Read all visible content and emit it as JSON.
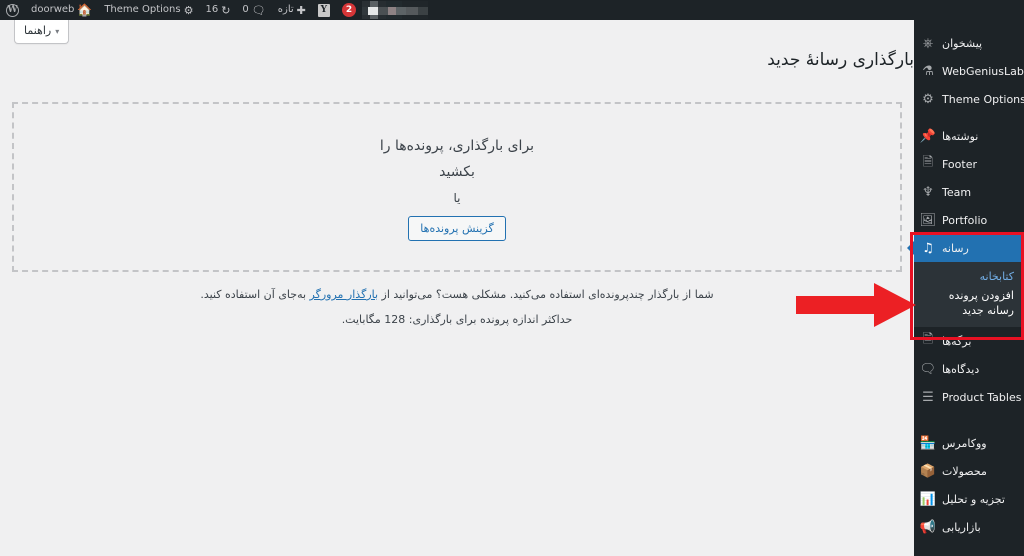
{
  "adminbar": {
    "wp_logo_icon": "wordpress-logo-icon",
    "home_icon": "home-icon",
    "site_name": "doorweb",
    "theme_options_label": "Theme Options",
    "theme_options_icon": "gear-icon",
    "updates_count": "16",
    "updates_icon": "update-icon",
    "comments_count": "0",
    "comments_icon": "comment-bubble-icon",
    "new_label": "تازه",
    "new_icon": "plus-icon",
    "yoast_icon": "yoast-seo-icon",
    "notifications_badge": "2",
    "blurred_region": "blurred-site-name"
  },
  "sidebar": {
    "items": [
      {
        "label": "پیشخوان",
        "icon": "dashboard-gauge-icon",
        "current": false
      },
      {
        "label": "WebGeniusLab",
        "icon": "flask-icon",
        "current": false
      },
      {
        "label": "Theme Options",
        "icon": "gear-icon",
        "current": false
      },
      {
        "label": "نوشته‌ها",
        "icon": "pin-icon",
        "current": false
      },
      {
        "label": "Footer",
        "icon": "page-icon",
        "current": false
      },
      {
        "label": "Team",
        "icon": "users-group-icon",
        "current": false
      },
      {
        "label": "Portfolio",
        "icon": "portfolio-image-icon",
        "current": false
      },
      {
        "label": "رسانه",
        "icon": "media-music-icon",
        "current": true
      },
      {
        "label": "برگه‌ها",
        "icon": "pages-icon",
        "current": false
      },
      {
        "label": "دیدگاه‌ها",
        "icon": "comment-bubble-icon",
        "current": false
      },
      {
        "label": "Product Tables",
        "icon": "table-lines-icon",
        "current": false
      },
      {
        "label": "ووکامرس",
        "icon": "woocommerce-icon",
        "current": false
      },
      {
        "label": "محصولات",
        "icon": "products-box-icon",
        "current": false
      },
      {
        "label": "تجزیه و تحلیل",
        "icon": "analytics-bars-icon",
        "current": false
      },
      {
        "label": "بازاریابی",
        "icon": "megaphone-icon",
        "current": false
      }
    ],
    "media_submenu": [
      {
        "label": "کتابخانه",
        "current": false
      },
      {
        "label": "افزودن پرونده رسانه جدید",
        "current": true
      }
    ]
  },
  "main": {
    "help_tab_label": "راهنما",
    "help_tab_caret": "▾",
    "page_title": "بارگذاری رسانهٔ جدید",
    "dropzone": {
      "drag_line_1": "برای بارگذاری، پرونده‌ها را",
      "drag_line_2": "بکشید",
      "or_label": "یا",
      "select_button_label": "گزینش پرونده‌ها"
    },
    "notices": {
      "multifile_prefix": "شما از بارگذار چندپرونده‌ای استفاده می‌کنید. مشکلی هست؟ می‌توانید از ",
      "multifile_link": "بارگذار مرورگر",
      "multifile_suffix": " به‌جای آن استفاده کنید.",
      "max_size_text": "حداکثر اندازه پرونده برای بارگذاری: 128 مگابایت."
    }
  },
  "annotation": {
    "highlight_color": "#e81123",
    "arrow_color": "#ec2024",
    "arrow_direction": "right",
    "highlight_target": "media-menu-with-submenu"
  },
  "colors": {
    "sidebar_bg": "#1d2327",
    "submenu_bg": "#2c3338",
    "active_blue": "#2271b1",
    "content_bg": "#f0f0f1",
    "link_blue": "#2271b1",
    "badge_red": "#d63638"
  }
}
